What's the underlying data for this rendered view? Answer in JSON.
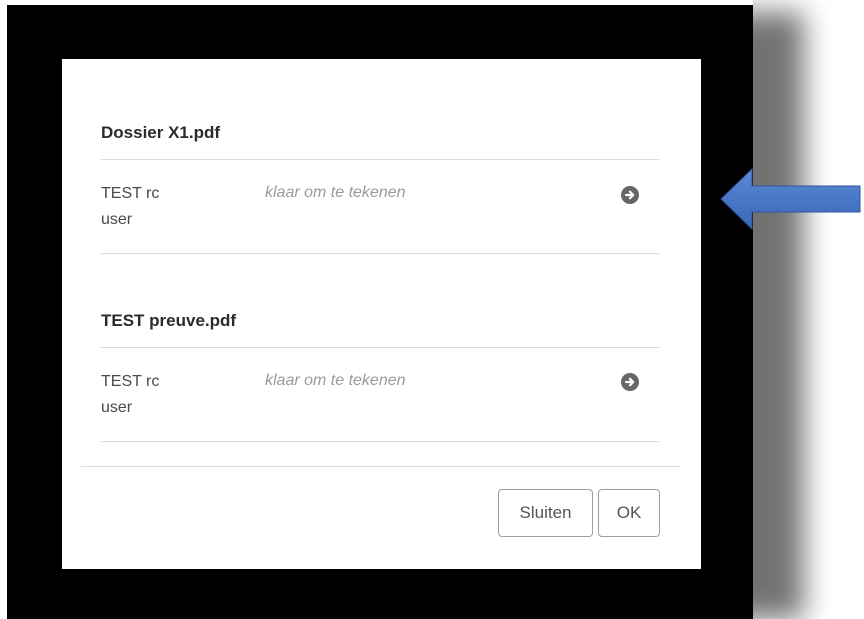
{
  "documents": [
    {
      "title": "Dossier X1.pdf",
      "signer": {
        "name": "TEST rc",
        "role": "user",
        "status": "klaar om te tekenen",
        "icon": "arrow-circle-right-icon"
      }
    },
    {
      "title": "TEST preuve.pdf",
      "signer": {
        "name": "TEST rc",
        "role": "user",
        "status": "klaar om te tekenen",
        "icon": "arrow-circle-right-icon"
      }
    }
  ],
  "footer": {
    "close_label": "Sluiten",
    "ok_label": "OK"
  },
  "colors": {
    "frame": "#000000",
    "modal": "#ffffff",
    "pointer_arrow": "#4472c4",
    "icon": "#666666"
  }
}
